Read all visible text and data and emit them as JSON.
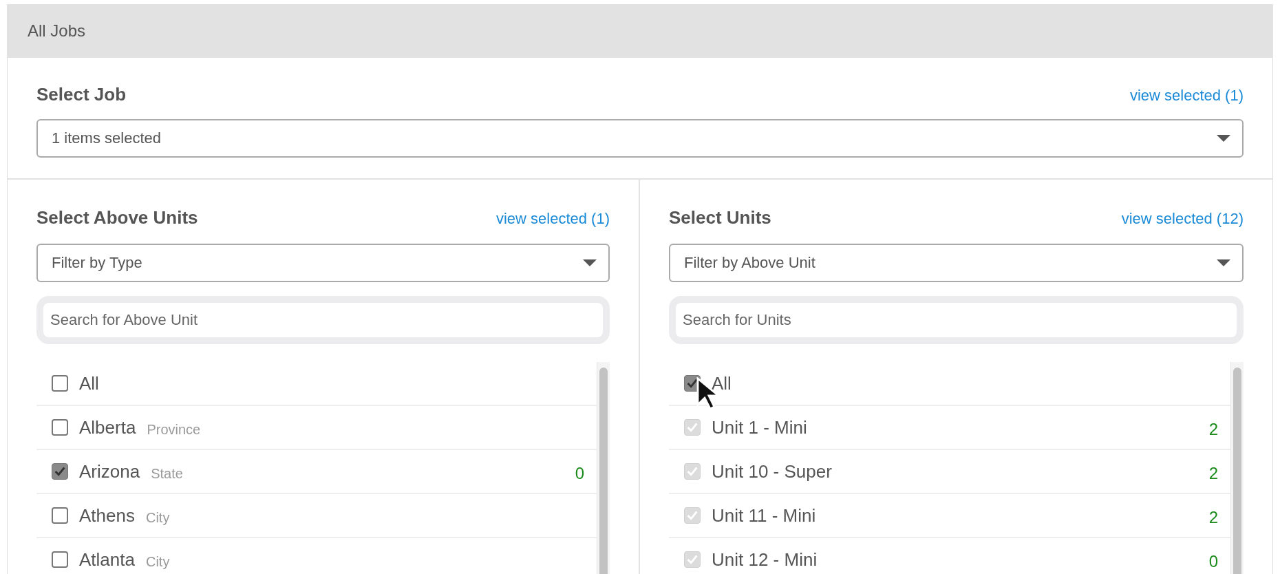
{
  "header": {
    "title": "All Jobs"
  },
  "job": {
    "title": "Select Job",
    "link": "view selected (1)",
    "select": {
      "value": "1 items selected"
    }
  },
  "columns": [
    {
      "title": "Select Above Units",
      "link": "view selected (1)",
      "filter": {
        "value": "Filter by Type"
      },
      "search": {
        "placeholder": "Search for Above Unit"
      },
      "items": [
        {
          "label": "All",
          "checked": false,
          "disabled": false
        },
        {
          "label": "Alberta",
          "type": "Province",
          "checked": false,
          "disabled": false
        },
        {
          "label": "Arizona",
          "type": "State",
          "count": "0",
          "checked": true,
          "disabled": false
        },
        {
          "label": "Athens",
          "type": "City",
          "checked": false,
          "disabled": false
        },
        {
          "label": "Atlanta",
          "type": "City",
          "checked": false,
          "disabled": false
        }
      ]
    },
    {
      "title": "Select Units",
      "link": "view selected (12)",
      "filter": {
        "value": "Filter by Above Unit"
      },
      "search": {
        "placeholder": "Search for Units"
      },
      "items": [
        {
          "label": "All",
          "checked": true,
          "disabled": false
        },
        {
          "label": "Unit 1 - Mini",
          "count": "2",
          "checked": true,
          "disabled": true
        },
        {
          "label": "Unit 10 - Super",
          "count": "2",
          "checked": true,
          "disabled": true
        },
        {
          "label": "Unit 11 - Mini",
          "count": "2",
          "checked": true,
          "disabled": true
        },
        {
          "label": "Unit 12 - Mini",
          "count": "0",
          "checked": true,
          "disabled": true
        }
      ]
    }
  ]
}
